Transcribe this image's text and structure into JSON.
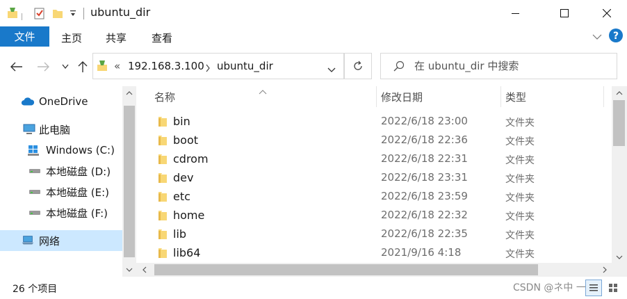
{
  "window": {
    "title": "ubuntu_dir"
  },
  "ribbon": {
    "tabs": [
      {
        "label": "文件"
      },
      {
        "label": "主页"
      },
      {
        "label": "共享"
      },
      {
        "label": "查看"
      }
    ],
    "file_tab_color": "#1979ca"
  },
  "address": {
    "overflow": "«",
    "parts": [
      "192.168.3.100",
      "ubuntu_dir"
    ]
  },
  "search": {
    "placeholder": "在 ubuntu_dir 中搜索"
  },
  "sidebar": {
    "items": [
      {
        "label": "OneDrive",
        "icon": "cloud-icon"
      },
      {
        "label": "此电脑",
        "icon": "computer-icon"
      },
      {
        "label": "Windows (C:)",
        "icon": "windows-drive-icon"
      },
      {
        "label": "本地磁盘 (D:)",
        "icon": "drive-icon"
      },
      {
        "label": "本地磁盘 (E:)",
        "icon": "drive-icon"
      },
      {
        "label": "本地磁盘 (F:)",
        "icon": "drive-icon"
      },
      {
        "label": "网络",
        "icon": "network-icon",
        "selected": true
      }
    ],
    "selected_color": "#cce8ff"
  },
  "columns": {
    "name": "名称",
    "date": "修改日期",
    "type": "类型"
  },
  "files": [
    {
      "name": "bin",
      "date": "2022/6/18 23:00",
      "type": "文件夹"
    },
    {
      "name": "boot",
      "date": "2022/6/18 22:36",
      "type": "文件夹"
    },
    {
      "name": "cdrom",
      "date": "2022/6/18 22:31",
      "type": "文件夹"
    },
    {
      "name": "dev",
      "date": "2022/6/18 23:31",
      "type": "文件夹"
    },
    {
      "name": "etc",
      "date": "2022/6/18 23:59",
      "type": "文件夹"
    },
    {
      "name": "home",
      "date": "2022/6/18 22:32",
      "type": "文件夹"
    },
    {
      "name": "lib",
      "date": "2022/6/18 22:35",
      "type": "文件夹"
    },
    {
      "name": "lib64",
      "date": "2021/9/16 4:18",
      "type": "文件夹"
    }
  ],
  "status": {
    "count": "26 个项目",
    "watermark": "CSDN @ネ中 一"
  },
  "colors": {
    "folder": "#f8d775",
    "accent": "#1979ca",
    "help": "#1979ca"
  }
}
